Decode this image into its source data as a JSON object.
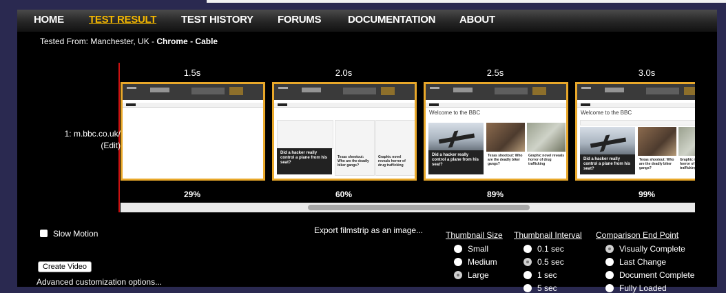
{
  "nav": {
    "items": [
      {
        "label": "HOME"
      },
      {
        "label": "TEST RESULT",
        "active": true
      },
      {
        "label": "TEST HISTORY"
      },
      {
        "label": "FORUMS"
      },
      {
        "label": "DOCUMENTATION"
      },
      {
        "label": "ABOUT"
      }
    ]
  },
  "tested": {
    "prefix": "Tested From: Manchester, UK - ",
    "browser": "Chrome",
    "sep": " - ",
    "connection": "Cable"
  },
  "row": {
    "label": "1: m.bbc.co.uk/",
    "edit": "(Edit)"
  },
  "frames": [
    {
      "time": "1.5s",
      "percent": "29%"
    },
    {
      "time": "2.0s",
      "percent": "60%"
    },
    {
      "time": "2.5s",
      "percent": "89%"
    },
    {
      "time": "3.0s",
      "percent": "99%"
    }
  ],
  "thumb_text": {
    "welcome": "Welcome to the BBC",
    "headline": "Did a hacker really control a plane from his seat?",
    "story2": "Texas shootout: Who are the deadly biker gangs?",
    "story3": "Graphic novel reveals horror of drug trafficking"
  },
  "controls": {
    "slow_motion": "Slow Motion",
    "create_video": "Create Video",
    "advanced": "Advanced customization options...",
    "export": "Export filmstrip as an image..."
  },
  "thumbnail_size": {
    "heading": "Thumbnail Size",
    "options": [
      "Small",
      "Medium",
      "Large"
    ],
    "selected": "Large"
  },
  "thumbnail_interval": {
    "heading": "Thumbnail Interval",
    "options": [
      "0.1 sec",
      "0.5 sec",
      "1 sec",
      "5 sec"
    ],
    "selected": "0.5 sec"
  },
  "comparison_end": {
    "heading": "Comparison End Point",
    "options": [
      "Visually Complete",
      "Last Change",
      "Document Complete",
      "Fully Loaded"
    ],
    "selected": "Visually Complete"
  },
  "colors": {
    "accent": "#f5b800",
    "frame_border": "#e9a82a",
    "timeline_marker": "#cc1111",
    "page_bg": "#2a2950"
  }
}
